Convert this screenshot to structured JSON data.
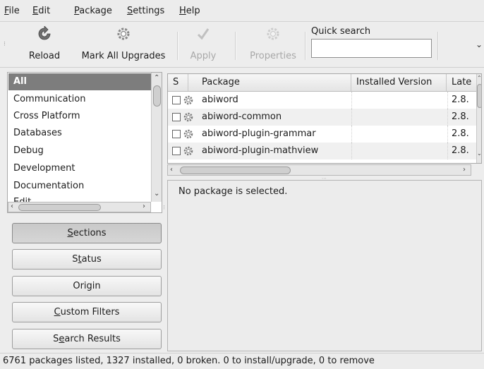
{
  "menu": [
    {
      "label": "File",
      "mnemonic": "F",
      "rest": "ile"
    },
    {
      "label": "Edit",
      "mnemonic": "E",
      "rest": "dit"
    },
    {
      "label": "Package",
      "mnemonic": "P",
      "rest": "ackage"
    },
    {
      "label": "Settings",
      "mnemonic": "S",
      "rest": "ettings"
    },
    {
      "label": "Help",
      "mnemonic": "H",
      "rest": "elp"
    }
  ],
  "toolbar": {
    "reload": "Reload",
    "mark_all": "Mark All Upgrades",
    "apply": "Apply",
    "properties": "Properties",
    "quick_search_label": "Quick search",
    "quick_search_value": ""
  },
  "sections": {
    "items": [
      "All",
      "Communication",
      "Cross Platform",
      "Databases",
      "Debug",
      "Development",
      "Documentation",
      "Edit"
    ],
    "selected": "All"
  },
  "buttons": {
    "sections": {
      "pre": "",
      "mn": "S",
      "post": "ections"
    },
    "status": {
      "pre": "S",
      "mn": "t",
      "post": "atus"
    },
    "origin": {
      "pre": "Origin",
      "mn": "",
      "post": ""
    },
    "custom": {
      "pre": "",
      "mn": "C",
      "post": "ustom Filters"
    },
    "search": {
      "pre": "S",
      "mn": "e",
      "post": "arch Results"
    }
  },
  "table": {
    "headers": [
      "S",
      "Package",
      "Installed Version",
      "Late"
    ],
    "rows": [
      {
        "name": "abiword",
        "latest": "2.8."
      },
      {
        "name": "abiword-common",
        "latest": "2.8."
      },
      {
        "name": "abiword-plugin-grammar",
        "latest": "2.8."
      },
      {
        "name": "abiword-plugin-mathview",
        "latest": "2.8."
      }
    ]
  },
  "details": {
    "text": "No package is selected."
  },
  "status": {
    "text": "6761 packages listed, 1327 installed, 0 broken. 0 to install/upgrade, 0 to remove"
  },
  "colors": {
    "selected_section": "#7d7d7d",
    "window_bg": "#ededed"
  }
}
